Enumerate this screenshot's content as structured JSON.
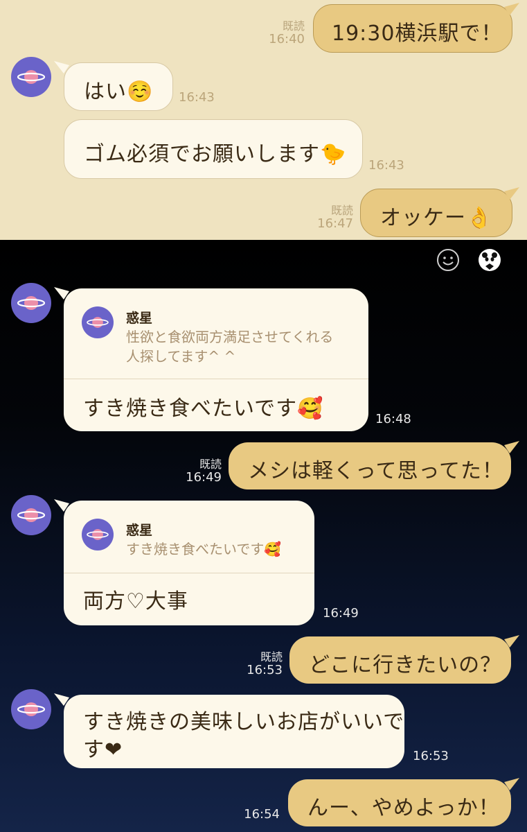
{
  "colors": {
    "top_bg": "#efe3c0",
    "incoming": "#fdf8ea",
    "outgoing": "#e8c982",
    "avatar": "#6a63c9"
  },
  "messages": [
    {
      "dir": "out",
      "text": "19:30横浜駅で！",
      "read": "既読",
      "time": "16:40"
    },
    {
      "dir": "in",
      "text": "はい☺️",
      "time": "16:43"
    },
    {
      "dir": "in",
      "text": "ゴム必須でお願いします🐤",
      "time": "16:43"
    },
    {
      "dir": "out",
      "text": "オッケー👌",
      "read": "既読",
      "time": "16:47"
    },
    {
      "dir": "in",
      "reply_name": "惑星",
      "reply_line1": "性欲と食欲両方満足させてくれる",
      "reply_line2": "人探してます^ ^",
      "text": "すき焼き食べたいです🥰",
      "time": "16:48"
    },
    {
      "dir": "out",
      "text": "メシは軽くって思ってた！",
      "read": "既読",
      "time": "16:49"
    },
    {
      "dir": "in",
      "reply_name": "惑星",
      "reply_line1": "すき焼き食べたいです🥰",
      "text": "両方♡大事",
      "time": "16:49"
    },
    {
      "dir": "out",
      "text": "どこに行きたいの？",
      "read": "既読",
      "time": "16:53"
    },
    {
      "dir": "in",
      "text_line1": "すき焼きの美味しいお店がいいで",
      "text_line2": "す❤",
      "time": "16:53"
    },
    {
      "dir": "out",
      "text": "んー、やめよっか！",
      "time": "16:54"
    }
  ],
  "icons": {
    "emoji": "smiley-icon",
    "profile": "panda-profile-icon",
    "avatar": "planet-icon"
  }
}
